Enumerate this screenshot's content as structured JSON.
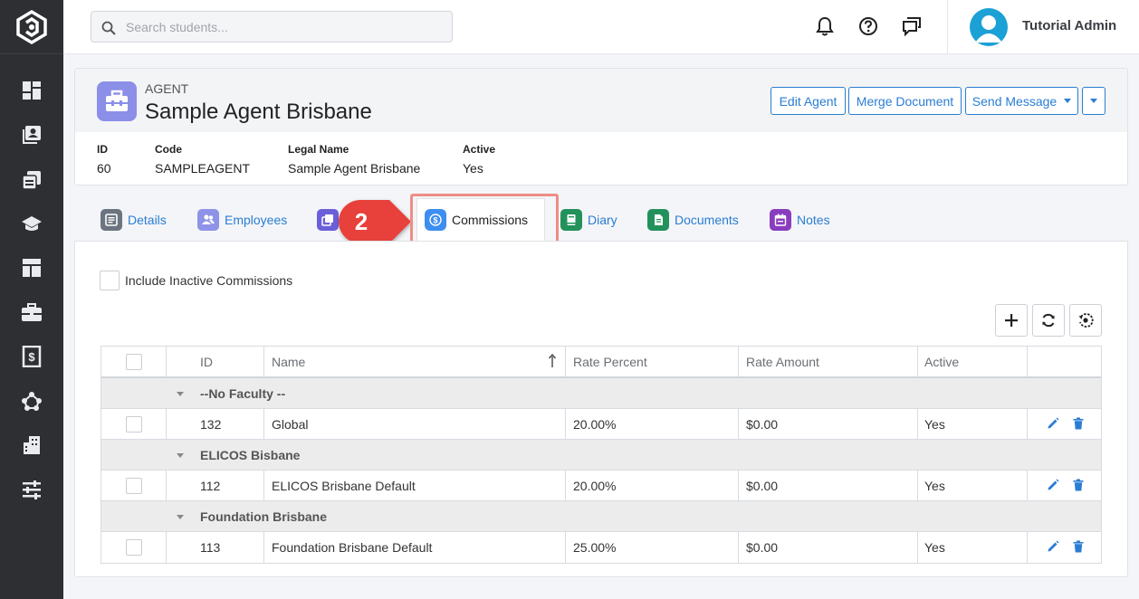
{
  "app": {
    "brand_icon": "logo-icon",
    "sidebar_icons": [
      "dashboard-icon",
      "contacts-icon",
      "documents-icon",
      "graduation-cap-icon",
      "layout-icon",
      "briefcase-icon",
      "invoice-icon",
      "network-icon",
      "building-icon",
      "sliders-icon"
    ]
  },
  "search": {
    "placeholder": "Search students..."
  },
  "user": {
    "name": "Tutorial Admin"
  },
  "agent": {
    "type_label": "AGENT",
    "name": "Sample Agent Brisbane",
    "buttons": {
      "edit": "Edit Agent",
      "merge": "Merge Document",
      "send": "Send Message"
    },
    "fields": [
      {
        "label": "ID",
        "value": "60"
      },
      {
        "label": "Code",
        "value": "SAMPLEAGENT"
      },
      {
        "label": "Legal Name",
        "value": "Sample Agent Brisbane"
      },
      {
        "label": "Active",
        "value": "Yes"
      }
    ]
  },
  "tabs": [
    {
      "label": "Details",
      "color": "#6c7480"
    },
    {
      "label": "Employees",
      "color": "#8e93e8"
    },
    {
      "label": "Commissions",
      "color": "#3d8ef0"
    },
    {
      "label": "Diary",
      "color": "#22915b"
    },
    {
      "label": "Documents",
      "color": "#22915b"
    },
    {
      "label": "Notes",
      "color": "#8a3dbf"
    }
  ],
  "step_marker": "2",
  "commissions": {
    "include_inactive_label": "Include Inactive Commissions",
    "columns": [
      "ID",
      "Name",
      "Rate Percent",
      "Rate Amount",
      "Active"
    ],
    "groups": [
      {
        "name": "--No Faculty --",
        "rows": [
          {
            "id": "132",
            "name": "Global",
            "rate_percent": "20.00%",
            "rate_amount": "$0.00",
            "active": "Yes"
          }
        ]
      },
      {
        "name": "ELICOS Bisbane",
        "rows": [
          {
            "id": "112",
            "name": "ELICOS Brisbane Default",
            "rate_percent": "20.00%",
            "rate_amount": "$0.00",
            "active": "Yes"
          }
        ]
      },
      {
        "name": "Foundation Brisbane",
        "rows": [
          {
            "id": "113",
            "name": "Foundation Brisbane Default",
            "rate_percent": "25.00%",
            "rate_amount": "$0.00",
            "active": "Yes"
          }
        ]
      }
    ]
  },
  "colors": {
    "accent": "#2a7dd3",
    "sidebar": "#2d2f33",
    "highlight": "#ef8d86",
    "marker": "#e8403a"
  }
}
